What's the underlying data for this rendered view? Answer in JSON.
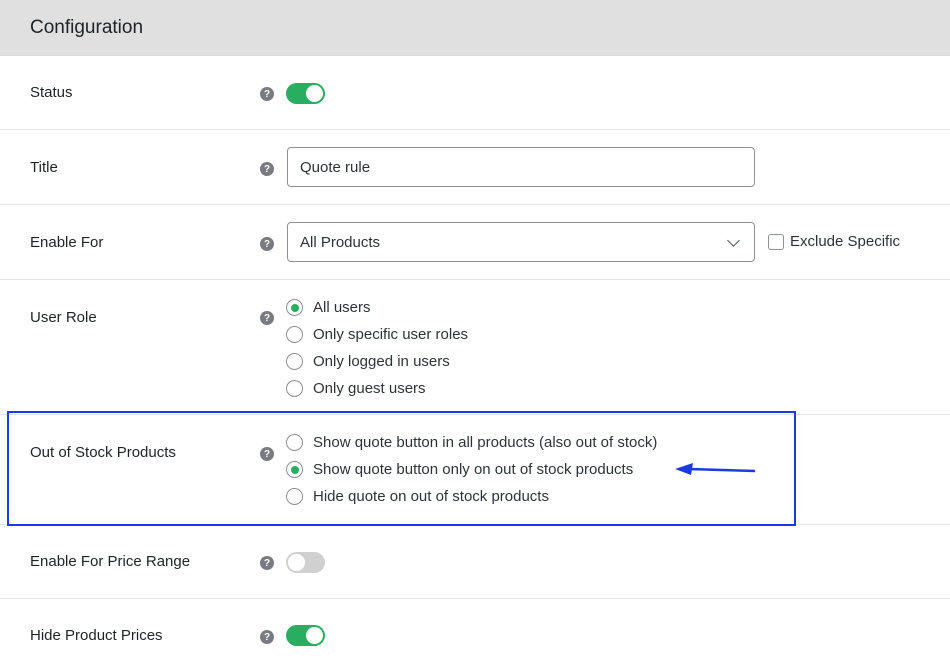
{
  "header": {
    "title": "Configuration"
  },
  "rows": {
    "status": {
      "label": "Status",
      "help_icon": "question-circle-icon",
      "toggle_on": true
    },
    "title": {
      "label": "Title",
      "help_icon": "question-circle-icon",
      "value": "Quote rule"
    },
    "enable_for": {
      "label": "Enable For",
      "help_icon": "question-circle-icon",
      "selected": "All Products",
      "exclude_label": "Exclude Specific",
      "exclude_checked": false
    },
    "user_role": {
      "label": "User Role",
      "help_icon": "question-circle-icon",
      "options": [
        "All users",
        "Only specific user roles",
        "Only logged in users",
        "Only guest users"
      ],
      "selected_index": 0
    },
    "out_of_stock": {
      "label": "Out of Stock Products",
      "help_icon": "question-circle-icon",
      "options": [
        "Show quote button in all products (also out of stock)",
        "Show quote button only on out of stock products",
        "Hide quote on out of stock products"
      ],
      "selected_index": 1
    },
    "price_range": {
      "label": "Enable For Price Range",
      "help_icon": "question-circle-icon",
      "toggle_on": false
    },
    "hide_prices": {
      "label": "Hide Product Prices",
      "help_icon": "question-circle-icon",
      "toggle_on": true
    }
  },
  "colors": {
    "accent_green": "#27ae60",
    "annotation_blue": "#1a3be0"
  }
}
